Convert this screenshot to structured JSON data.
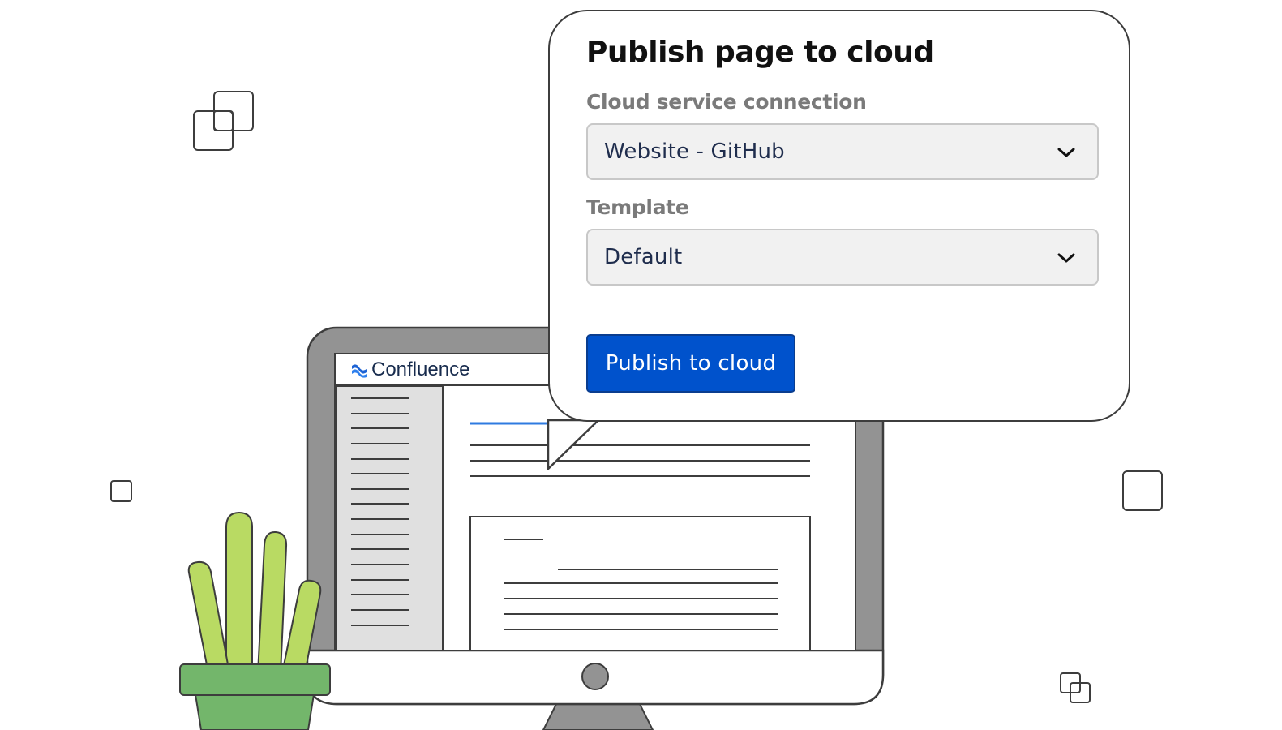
{
  "dialog": {
    "title": "Publish page to cloud",
    "connection_label": "Cloud service connection",
    "connection_value": "Website - GitHub",
    "template_label": "Template",
    "template_value": "Default",
    "publish_button": "Publish to cloud"
  },
  "app": {
    "name": "Confluence",
    "logo_icon": "confluence-logo-icon"
  },
  "colors": {
    "accent": "#0052cc",
    "plant": "#b9da63",
    "pot": "#73b66b",
    "monitor": "#939393"
  }
}
